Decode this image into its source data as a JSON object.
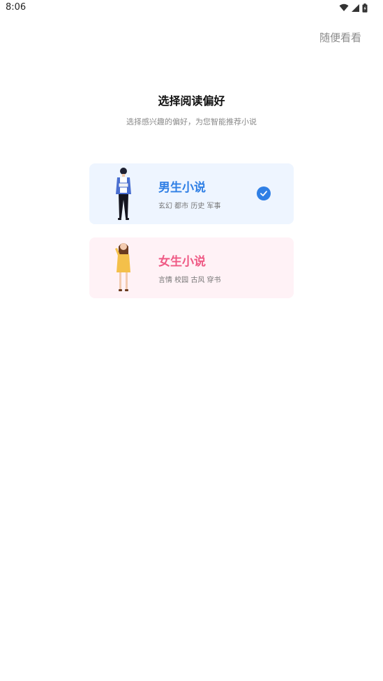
{
  "status_bar": {
    "time": "8:06"
  },
  "header": {
    "skip_label": "随便看看"
  },
  "intro": {
    "title": "选择阅读偏好",
    "subtitle": "选择感兴趣的偏好，为您智能推荐小说"
  },
  "options": [
    {
      "title": "男生小说",
      "tags": "玄幻 都市 历史 军事",
      "selected": true,
      "accent_color": "#2f7fe5",
      "background_color": "#eef5ff",
      "illustration_icon": "male-reader-illustration"
    },
    {
      "title": "女生小说",
      "tags": "言情 校园 古风 穿书",
      "selected": false,
      "accent_color": "#ef5a85",
      "background_color": "#fff2f6",
      "illustration_icon": "female-reader-illustration"
    }
  ],
  "selected_icon": "check-circle-icon"
}
